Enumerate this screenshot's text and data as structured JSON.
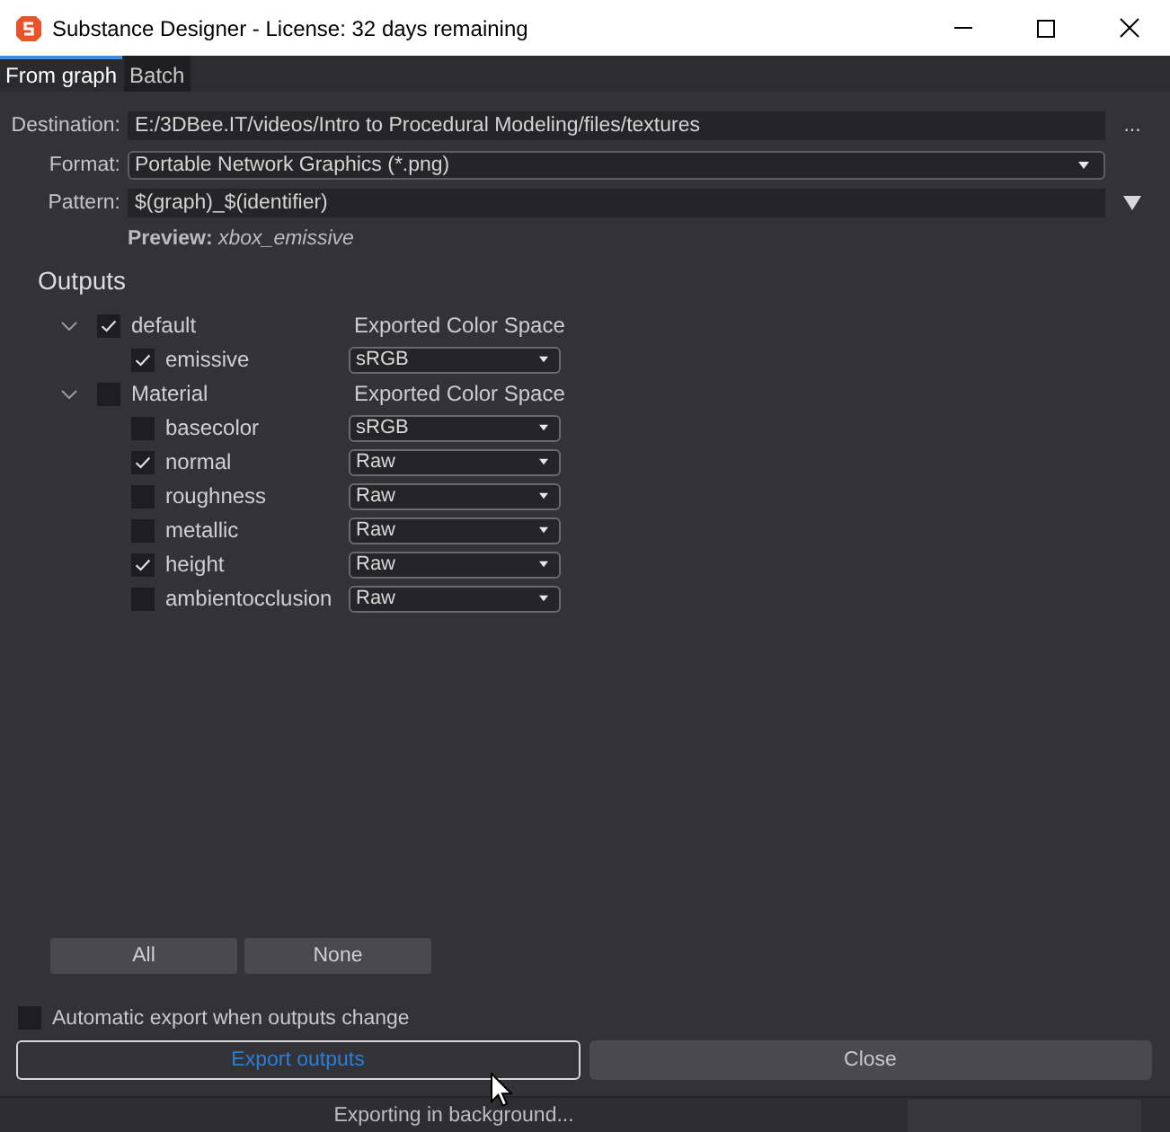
{
  "window": {
    "title": "Substance Designer - License: 32 days remaining"
  },
  "tabs": [
    {
      "label": "From graph",
      "selected": true
    },
    {
      "label": "Batch",
      "selected": false
    }
  ],
  "export_settings": [
    {
      "kind": "path",
      "label": "Destination:",
      "value": "E:/3DBee.IT/videos/Intro to Procedural Modeling/files/textures",
      "trailing": "..."
    },
    {
      "kind": "select",
      "label": "Format:",
      "value": "Portable Network Graphics (*.png)"
    },
    {
      "kind": "combo",
      "label": "Pattern:",
      "value": "$(graph)_$(identifier)"
    }
  ],
  "preview": "**Preview:** *xbox_emissive*",
  "outputs": {
    "heading": "Outputs",
    "groups": [
      {
        "name": "default",
        "checked": true,
        "expanded": true,
        "column_label": "Exported Color Space",
        "items": [
          {
            "name": "emissive",
            "checked": true,
            "color_space": "sRGB"
          }
        ]
      },
      {
        "name": "Material",
        "checked": false,
        "expanded": true,
        "column_label": "Exported Color Space",
        "items": [
          {
            "name": "basecolor",
            "checked": false,
            "color_space": "sRGB"
          },
          {
            "name": "normal",
            "checked": true,
            "color_space": "Raw"
          },
          {
            "name": "roughness",
            "checked": false,
            "color_space": "Raw"
          },
          {
            "name": "metallic",
            "checked": false,
            "color_space": "Raw"
          },
          {
            "name": "height",
            "checked": true,
            "color_space": "Raw"
          },
          {
            "name": "ambientocclusion",
            "checked": false,
            "color_space": "Raw"
          }
        ]
      }
    ]
  },
  "selection_buttons": [
    "All",
    "None"
  ],
  "auto_export": {
    "label": "Automatic export when outputs change",
    "checked": false
  },
  "actions": [
    {
      "label": "Export outputs",
      "focused": true
    },
    {
      "label": "Close",
      "focused": false
    }
  ],
  "status_bar": {
    "text": "Exporting in background..."
  }
}
